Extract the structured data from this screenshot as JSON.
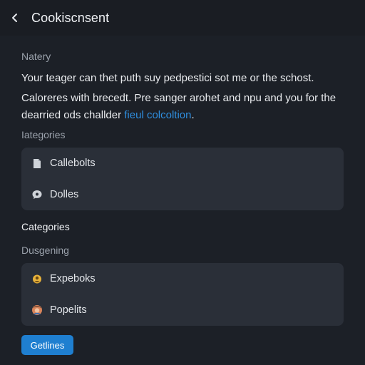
{
  "header": {
    "back_icon": "chevron-left-icon",
    "title": "Cookiscnsent"
  },
  "notice": {
    "label": "Natery",
    "paragraph1": "Your teager can thet puth suy pedpestici sot me or the schost.",
    "paragraph2_prefix": "Caloreres with brecedt. Pre sanger arohet and npu and you for the dearried ods challder ",
    "paragraph2_link": "fieul colcoltion",
    "paragraph2_suffix": "."
  },
  "categories_section": {
    "label": "Iategories",
    "items": [
      {
        "label": "Callebolts",
        "icon": "document-icon"
      },
      {
        "label": "Dolles",
        "icon": "chat-bubble-icon"
      }
    ]
  },
  "second_section": {
    "heading": "Categories",
    "label": "Dusgening",
    "items": [
      {
        "label": "Expeboks",
        "icon": "badge-icon"
      },
      {
        "label": "Popelits",
        "icon": "user-avatar-icon"
      }
    ]
  },
  "primary_button": {
    "label": "Getlines"
  },
  "colors": {
    "background": "#1c2027",
    "card": "#2a2f38",
    "accent": "#1f7fd0",
    "link": "#2f8fe0"
  }
}
